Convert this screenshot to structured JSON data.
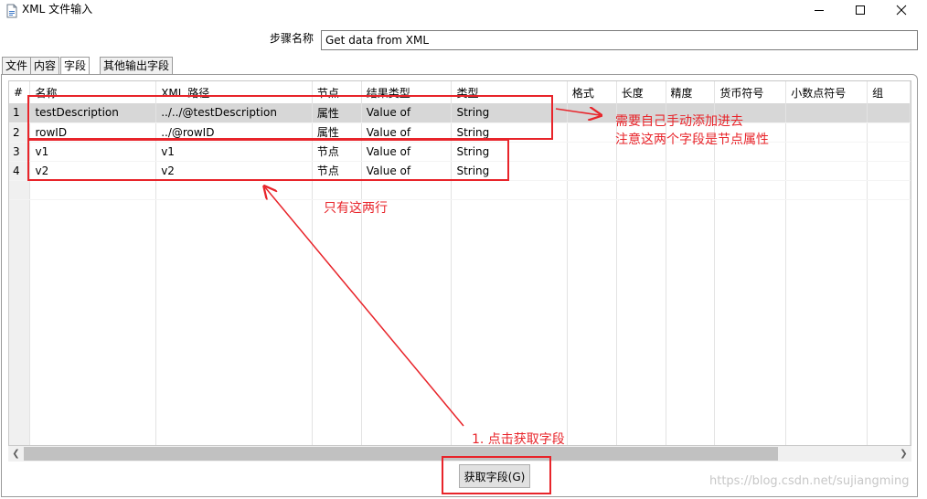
{
  "window": {
    "title": "XML 文件输入",
    "minimize_icon": "minimize-icon",
    "maximize_icon": "maximize-icon",
    "close_icon": "close-icon"
  },
  "step": {
    "label": "步骤名称",
    "value": "Get data from XML"
  },
  "tabs": [
    {
      "label": "文件",
      "active": false
    },
    {
      "label": "内容",
      "active": false
    },
    {
      "label": "字段",
      "active": true
    },
    {
      "label": "其他输出字段",
      "active": false
    }
  ],
  "table": {
    "columns": [
      "#",
      "名称",
      "XML 路径",
      "节点",
      "结果类型",
      "类型",
      "格式",
      "长度",
      "精度",
      "货币符号",
      "小数点符号",
      "组"
    ],
    "rows": [
      {
        "num": "1",
        "name": "testDescription",
        "path": "../../@testDescription",
        "node": "属性",
        "result_type": "Value of",
        "type": "String"
      },
      {
        "num": "2",
        "name": "rowID",
        "path": "../@rowID",
        "node": "属性",
        "result_type": "Value of",
        "type": "String"
      },
      {
        "num": "3",
        "name": "v1",
        "path": "v1",
        "node": "节点",
        "result_type": "Value of",
        "type": "String"
      },
      {
        "num": "4",
        "name": "v2",
        "path": "v2",
        "node": "节点",
        "result_type": "Value of",
        "type": "String"
      }
    ],
    "selected_row": 1
  },
  "buttons": {
    "get_fields": "获取字段(G)"
  },
  "annotations": {
    "note1_line1": "需要自己手动添加进去",
    "note1_line2": "注意这两个字段是节点属性",
    "note2": "只有这两行",
    "note3": "1. 点击获取字段",
    "color": "#e8242a"
  },
  "watermark": "https://blog.csdn.net/sujiangming"
}
